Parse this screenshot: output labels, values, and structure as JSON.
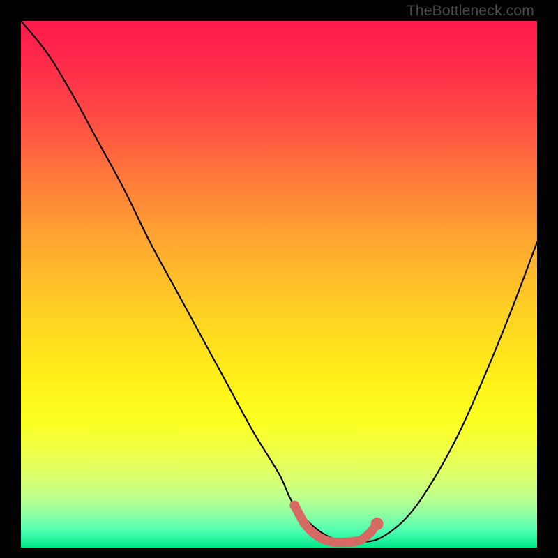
{
  "watermark": "TheBottleneck.com",
  "chart_data": {
    "type": "line",
    "title": "",
    "xlabel": "",
    "ylabel": "",
    "xlim": [
      0,
      100
    ],
    "ylim": [
      0,
      100
    ],
    "series": [
      {
        "name": "bottleneck-curve",
        "color": "#000000",
        "x": [
          0,
          5,
          10,
          15,
          20,
          25,
          30,
          35,
          40,
          45,
          50,
          53,
          58,
          63,
          66,
          70,
          75,
          80,
          85,
          90,
          95,
          100
        ],
        "y": [
          100,
          94,
          86,
          77,
          68,
          58,
          49,
          40,
          31,
          22,
          14,
          8,
          3,
          1,
          1,
          2,
          6,
          13,
          22,
          33,
          45,
          58
        ]
      },
      {
        "name": "flat-zone-highlight",
        "color": "#d66a62",
        "x": [
          53,
          55,
          57,
          59,
          61,
          63,
          65,
          66,
          67,
          68,
          69
        ],
        "y": [
          8,
          4.5,
          2.5,
          1.4,
          1,
          1,
          1.2,
          1.5,
          2.2,
          3.2,
          4.5
        ]
      }
    ],
    "markers": [
      {
        "name": "marker-left",
        "x": 53,
        "y": 8,
        "color": "#d66a62",
        "r": 7
      },
      {
        "name": "marker-right",
        "x": 69,
        "y": 4.5,
        "color": "#d66a62",
        "r": 9
      }
    ]
  }
}
